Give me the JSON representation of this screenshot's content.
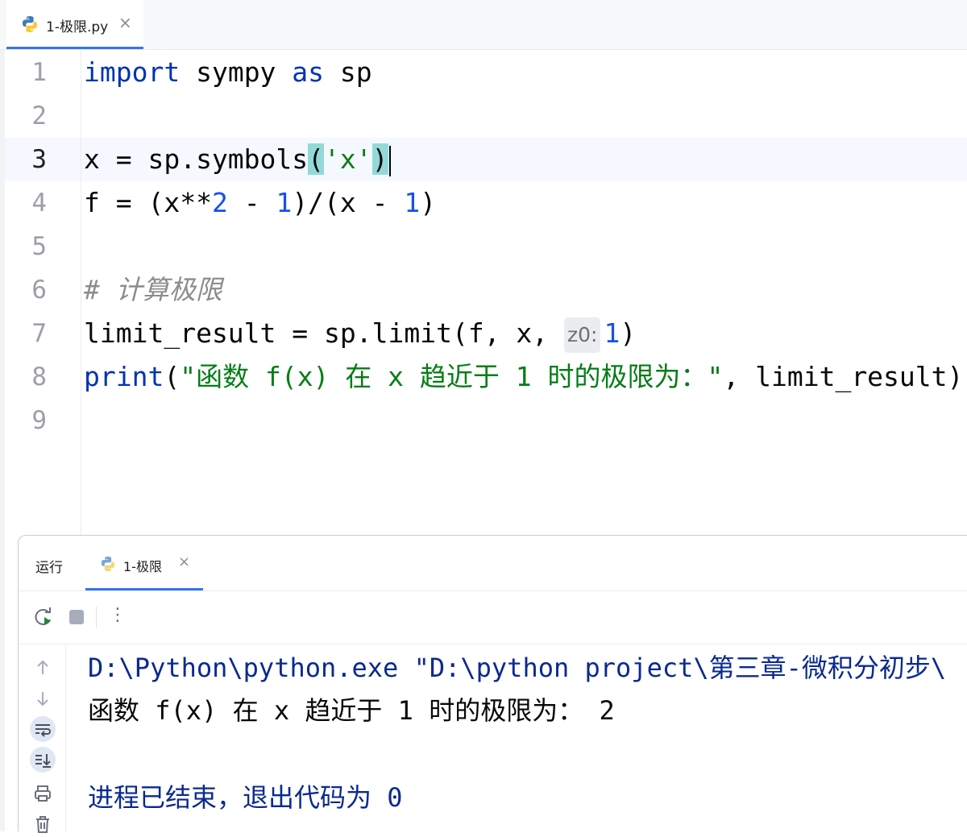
{
  "editor_tab": {
    "file_name": "1-极限.py",
    "close": "×"
  },
  "code_lines": [
    {
      "n": "1",
      "parts": [
        {
          "t": "import",
          "c": "kw"
        },
        {
          "t": " sympy "
        },
        {
          "t": "as",
          "c": "kw"
        },
        {
          "t": " sp"
        }
      ]
    },
    {
      "n": "2",
      "parts": []
    },
    {
      "n": "3",
      "current": true,
      "parts": [
        {
          "t": "x = sp.symbols"
        },
        {
          "t": "(",
          "c": "brace"
        },
        {
          "t": "'x'",
          "c": "str"
        },
        {
          "t": ")",
          "c": "brace"
        },
        {
          "caret": true
        }
      ]
    },
    {
      "n": "4",
      "parts": [
        {
          "t": "f = (x**"
        },
        {
          "t": "2",
          "c": "num"
        },
        {
          "t": " - "
        },
        {
          "t": "1",
          "c": "num"
        },
        {
          "t": ")/(x - "
        },
        {
          "t": "1",
          "c": "num"
        },
        {
          "t": ")"
        }
      ]
    },
    {
      "n": "5",
      "parts": []
    },
    {
      "n": "6",
      "parts": [
        {
          "t": "# 计算极限",
          "c": "cm"
        }
      ]
    },
    {
      "n": "7",
      "parts": [
        {
          "t": "limit_result = sp.limit(f, x, "
        },
        {
          "hint": "z0:"
        },
        {
          "t": "1",
          "c": "num"
        },
        {
          "t": ")"
        }
      ]
    },
    {
      "n": "8",
      "parts": [
        {
          "t": "print",
          "c": "kw"
        },
        {
          "t": "("
        },
        {
          "t": "\"函数 f(x) 在 x 趋近于 1 时的极限为：\"",
          "c": "str"
        },
        {
          "t": ", limit_result)"
        }
      ]
    },
    {
      "n": "9",
      "parts": []
    }
  ],
  "run_window": {
    "title": "运行",
    "tab_label": "1-极限",
    "tab_close": "×",
    "toolbar": {
      "rerun": "rerun-icon",
      "stop": "stop-icon",
      "more": "⋮"
    },
    "side_buttons": [
      "arrow-up-icon",
      "arrow-down-icon",
      "soft-wrap-icon",
      "scroll-to-end-icon",
      "print-icon",
      "trash-icon"
    ],
    "console": {
      "command": "D:\\Python\\python.exe \"D:\\python project\\第三章-微积分初步\\",
      "output": "函数 f(x) 在 x 趋近于 1 时的极限为： 2",
      "exit": "进程已结束，退出代码为 0"
    }
  }
}
